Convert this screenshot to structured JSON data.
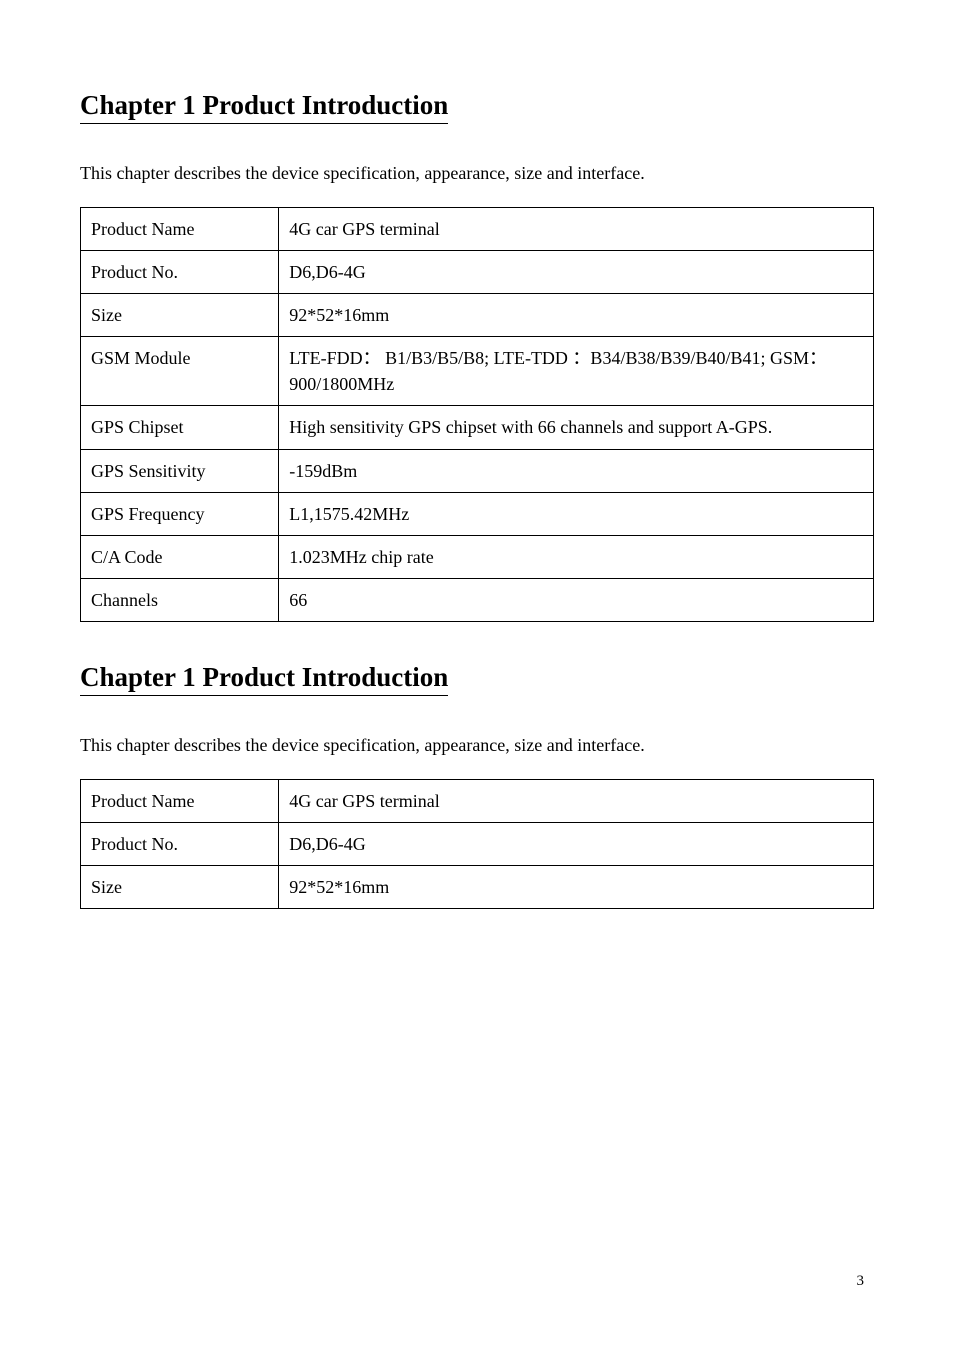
{
  "sections": [
    {
      "heading": "Chapter 1 Product Introduction",
      "intro": "This chapter describes the device specification, appearance, size and interface.",
      "rows": [
        {
          "label": "Product Name",
          "value": "4G car GPS terminal"
        },
        {
          "label": "Product No.",
          "value": "D6,D6-4G"
        },
        {
          "label": "Size",
          "value": "92*52*16mm"
        },
        {
          "label": "GSM Module",
          "value": "LTE-FDD： B1/B3/B5/B8; LTE-TDD ：B34/B38/B39/B40/B41; GSM：900/1800MHz"
        },
        {
          "label": "GPS Chipset",
          "value": "High sensitivity GPS chipset with 66 channels and support A-GPS."
        },
        {
          "label": "GPS Sensitivity",
          "value": "-159dBm"
        },
        {
          "label": "GPS Frequency",
          "value": "L1,1575.42MHz"
        },
        {
          "label": "C/A Code",
          "value": "1.023MHz chip rate"
        },
        {
          "label": "Channels",
          "value": "66"
        }
      ]
    },
    {
      "heading": "Chapter 1 Product Introduction",
      "intro": "This chapter describes the device specification, appearance, size and interface.",
      "rows": [
        {
          "label": "Product Name",
          "value": "4G car GPS terminal"
        },
        {
          "label": "Product No.",
          "value": "D6,D6-4G"
        },
        {
          "label": "Size",
          "value": "92*52*16mm"
        }
      ]
    }
  ],
  "page_number": "3"
}
